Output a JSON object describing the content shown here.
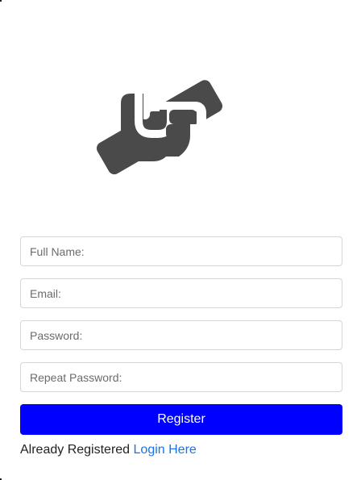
{
  "logo": {
    "icon": "handshake-icon",
    "color": "#4a4a4a"
  },
  "form": {
    "full_name_placeholder": "Full Name:",
    "email_placeholder": "Email:",
    "password_placeholder": "Password:",
    "repeat_password_placeholder": "Repeat Password:",
    "register_label": "Register",
    "already_text": "Already Registered",
    "login_link_label": "Login Here"
  },
  "colors": {
    "register_button": "#0000ff",
    "link": "#1a73e8"
  }
}
